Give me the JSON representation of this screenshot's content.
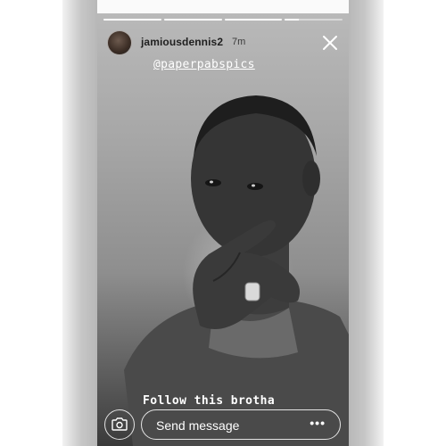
{
  "story": {
    "progress": [
      1,
      1,
      1,
      0.25
    ],
    "user": {
      "username": "jamiousdennis2",
      "timestamp": "7m"
    },
    "mention": "@paperpabspics",
    "caption": "Follow this brotha",
    "reply": {
      "placeholder": "Send message"
    }
  },
  "icons": {
    "close": "close-icon",
    "camera": "camera-icon",
    "more": "more-options-icon"
  },
  "colors": {
    "overlay_text": "#ffffff",
    "header_text": "#1f1f1f"
  }
}
